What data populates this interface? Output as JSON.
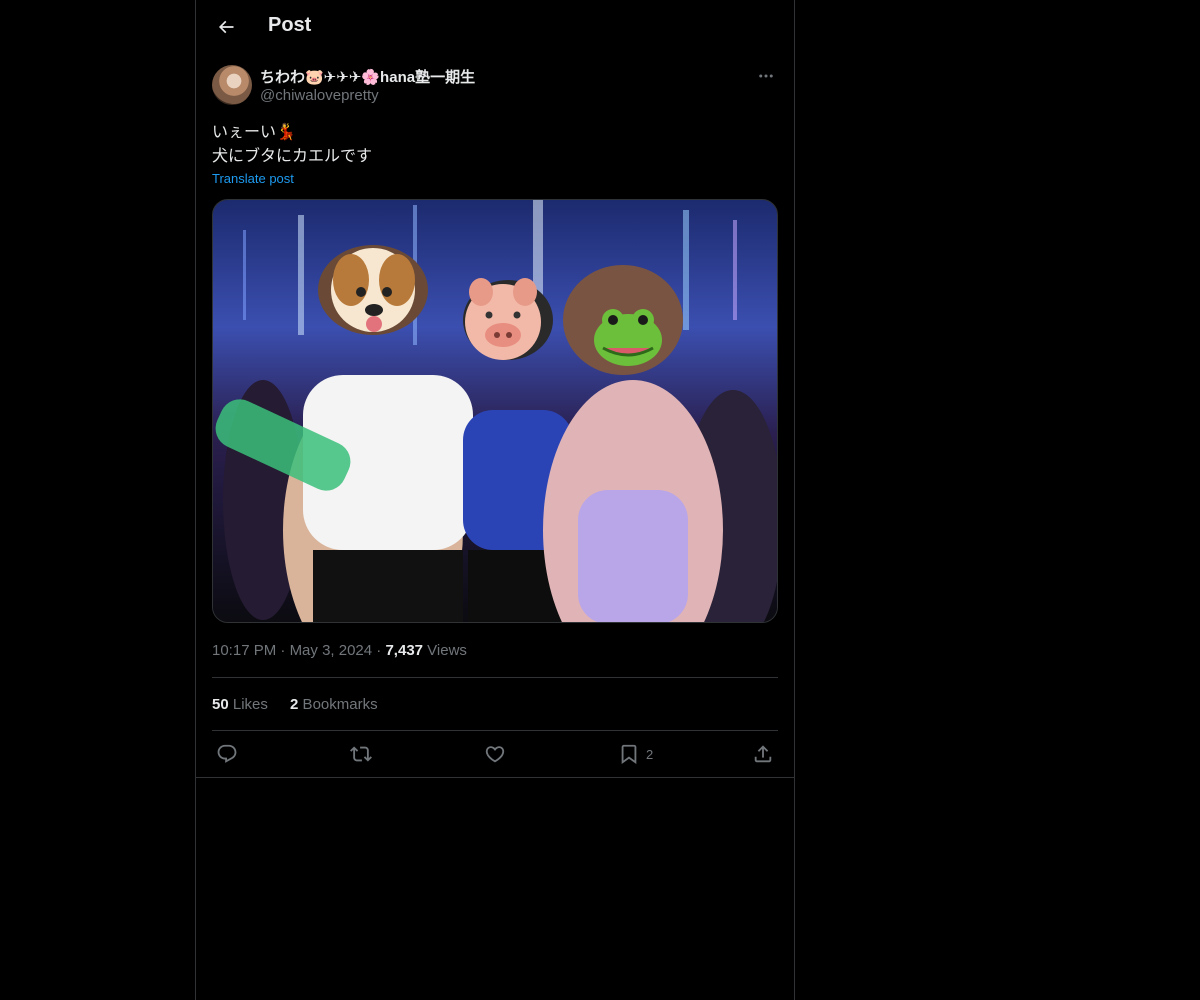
{
  "header": {
    "title": "Post",
    "back_icon": "arrow-left-icon"
  },
  "author": {
    "display_name": "ちわわ🐷✈✈✈🌸hana塾一期生",
    "handle": "@chiwalovepretty"
  },
  "post": {
    "text_line1": "いぇーい💃",
    "text_line2": "犬にブタにカエルです",
    "translate_label": "Translate post"
  },
  "meta": {
    "time": "10:17 PM",
    "sep1": " · ",
    "date": "May 3, 2024",
    "sep2": " · ",
    "views_count": "7,437",
    "views_label": " Views"
  },
  "stats": {
    "likes_count": "50",
    "likes_label": " Likes",
    "bookmarks_count": "2",
    "bookmarks_label": " Bookmarks"
  },
  "actions": {
    "reply_icon": "reply-icon",
    "repost_icon": "repost-icon",
    "like_icon": "heart-icon",
    "bookmark_icon": "bookmark-icon",
    "bookmark_count": "2",
    "share_icon": "share-icon"
  },
  "colors": {
    "background": "#000000",
    "border": "#2f3336",
    "text_primary": "#e7e9ea",
    "text_secondary": "#71767b",
    "link": "#1d9bf0"
  }
}
